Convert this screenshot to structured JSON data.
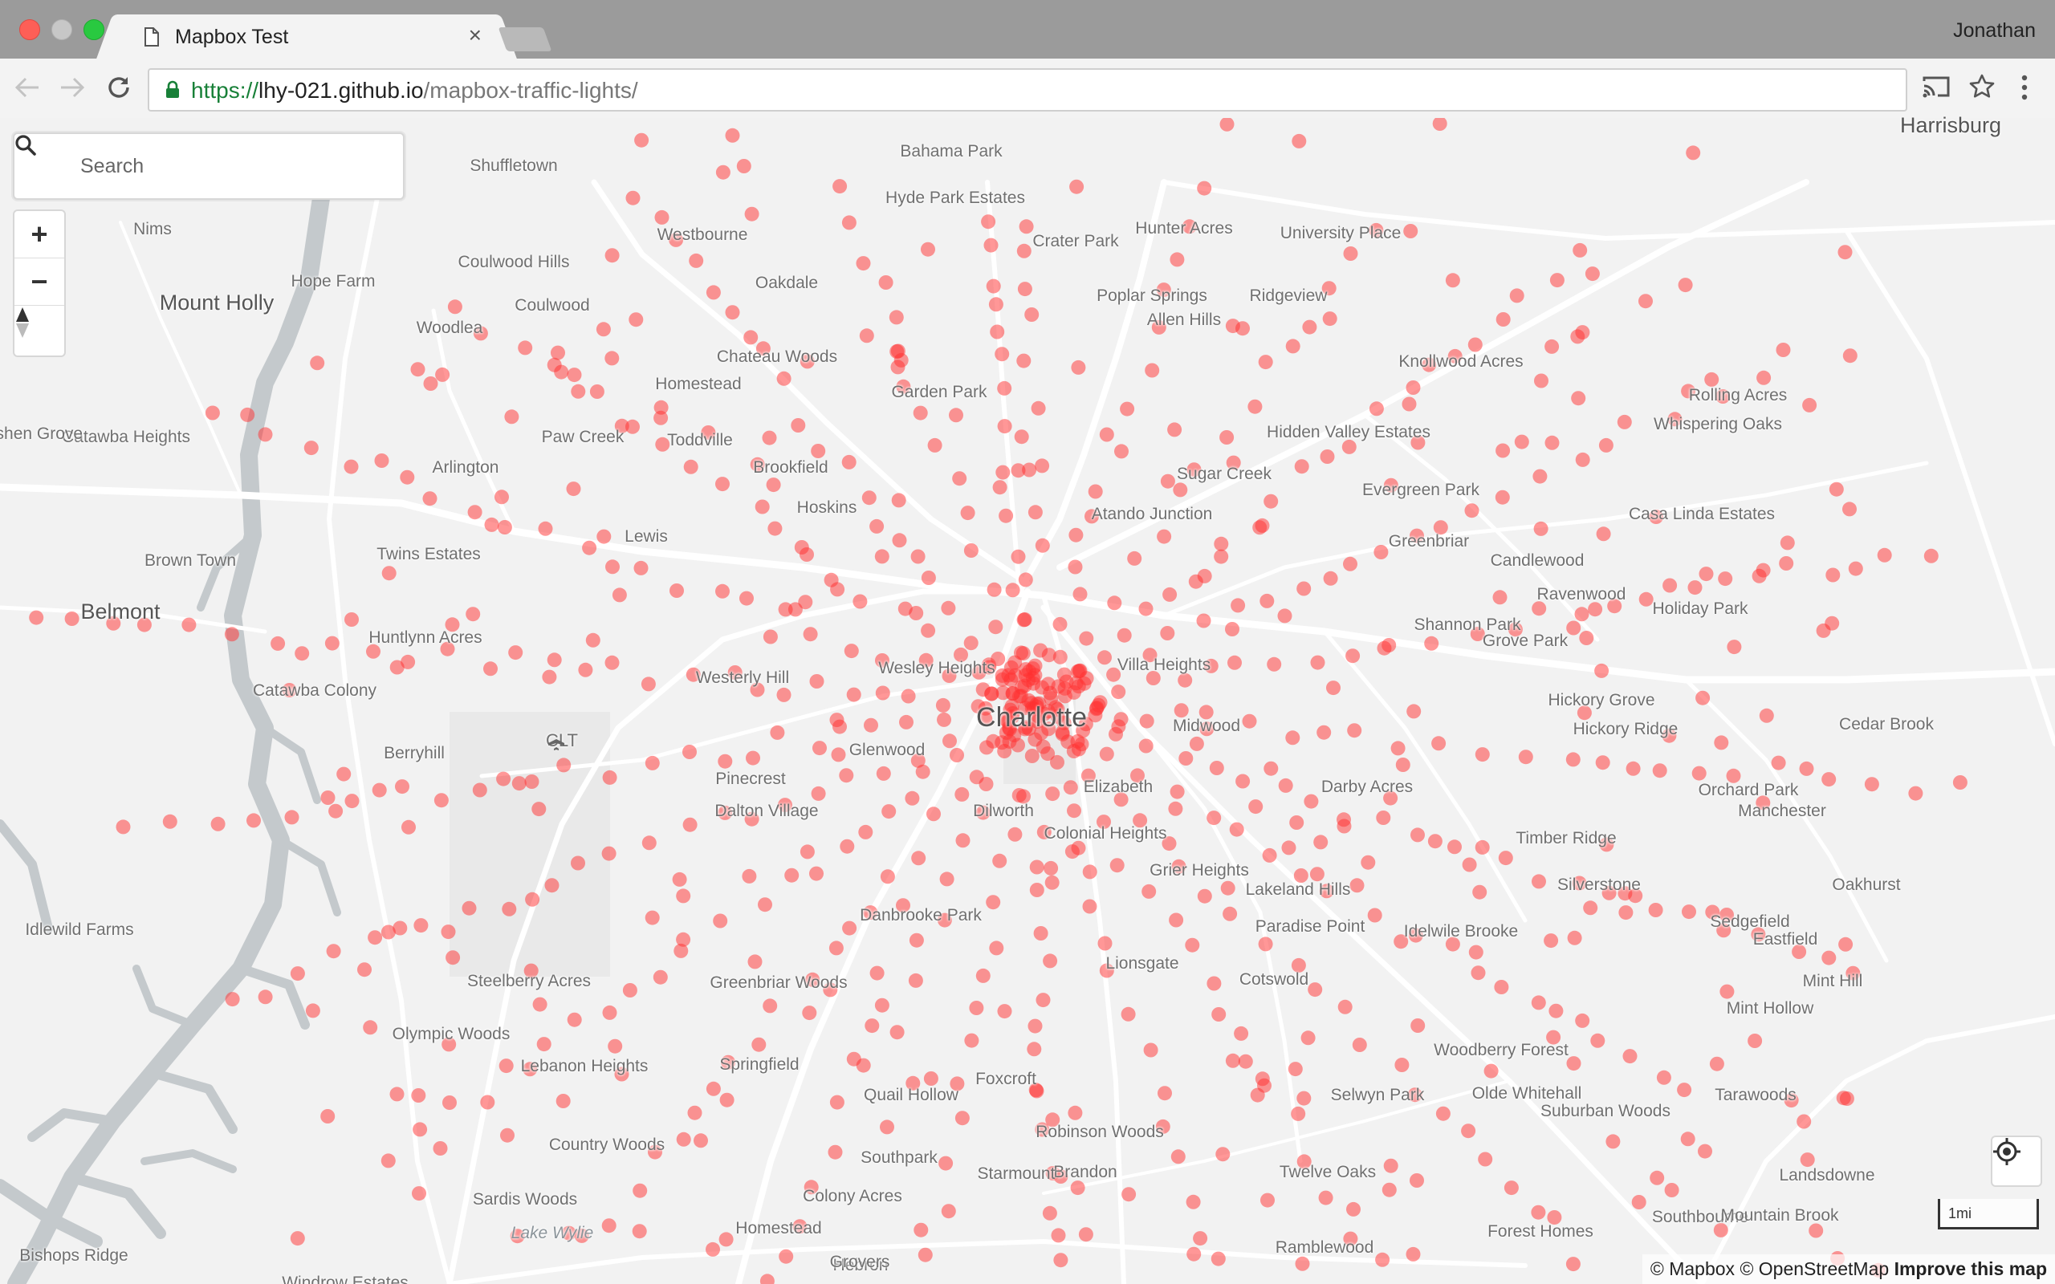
{
  "window": {
    "user_name": "Jonathan"
  },
  "tab": {
    "title": "Mapbox Test",
    "close": "×"
  },
  "address_bar": {
    "scheme": "https://",
    "host": "lhy-021.github.io",
    "path": "/mapbox-traffic-lights/"
  },
  "map": {
    "search_placeholder": "Search",
    "zoom_in": "+",
    "zoom_out": "−",
    "scale_label": "1mi",
    "attribution": [
      "© Mapbox",
      "© OpenStreetMap",
      "Improve this map"
    ],
    "airport_code": "CLT",
    "dot_color": "#ff3030",
    "places": [
      [
        "Harrisburg",
        "big"
      ],
      [
        "Shuffletown",
        ""
      ],
      [
        "Bahama Park",
        ""
      ],
      [
        "Hyde Park Estates",
        ""
      ],
      [
        "Hunter Acres",
        ""
      ],
      [
        "University Place",
        ""
      ],
      [
        "Nims",
        ""
      ],
      [
        "Westbourne",
        ""
      ],
      [
        "Crater Park",
        ""
      ],
      [
        "Coulwood Hills",
        ""
      ],
      [
        "Oakdale",
        ""
      ],
      [
        "Hope Farm",
        ""
      ],
      [
        "Mount Holly",
        "big"
      ],
      [
        "Coulwood",
        ""
      ],
      [
        "Poplar Springs",
        ""
      ],
      [
        "Ridgeview",
        ""
      ],
      [
        "Allen Hills",
        ""
      ],
      [
        "Woodlea",
        ""
      ],
      [
        "Chateau Woods",
        ""
      ],
      [
        "Knollwood Acres",
        ""
      ],
      [
        "Homestead",
        ""
      ],
      [
        "Garden Park",
        ""
      ],
      [
        "Rolling Acres",
        ""
      ],
      [
        "Whispering Oaks",
        ""
      ],
      [
        "Hidden Valley Estates",
        ""
      ],
      [
        "Catawba Heights",
        ""
      ],
      [
        "Paw Creek",
        ""
      ],
      [
        "Toddville",
        ""
      ],
      [
        "ashen Grove",
        ""
      ],
      [
        "Brookfield",
        ""
      ],
      [
        "Sugar Creek",
        ""
      ],
      [
        "Arlington",
        ""
      ],
      [
        "Evergreen Park",
        ""
      ],
      [
        "Hoskins",
        ""
      ],
      [
        "Atando Junction",
        ""
      ],
      [
        "Casa Linda Estates",
        ""
      ],
      [
        "Lewis",
        ""
      ],
      [
        "Greenbriar",
        ""
      ],
      [
        "Twins Estates",
        ""
      ],
      [
        "Brown Town",
        ""
      ],
      [
        "Candlewood",
        ""
      ],
      [
        "Ravenwood",
        ""
      ],
      [
        "Holiday Park",
        ""
      ],
      [
        "Belmont",
        "big"
      ],
      [
        "Shannon Park",
        ""
      ],
      [
        "Huntlynn Acres",
        ""
      ],
      [
        "Grove Park",
        ""
      ],
      [
        "Villa Heights",
        ""
      ],
      [
        "Wesley Heights",
        ""
      ],
      [
        "Westerly Hill",
        ""
      ],
      [
        "Catawba Colony",
        ""
      ],
      [
        "Charlotte",
        "city"
      ],
      [
        "Hickory Grove",
        ""
      ],
      [
        "Cedar Brook",
        ""
      ],
      [
        "Midwood",
        ""
      ],
      [
        "Hickory Ridge",
        ""
      ],
      [
        "Berryhill",
        ""
      ],
      [
        "Glenwood",
        ""
      ],
      [
        "Pinecrest",
        ""
      ],
      [
        "Darby Acres",
        ""
      ],
      [
        "Elizabeth",
        ""
      ],
      [
        "Orchard Park",
        ""
      ],
      [
        "Dalton Village",
        ""
      ],
      [
        "Dilworth",
        ""
      ],
      [
        "Manchester",
        ""
      ],
      [
        "Colonial Heights",
        ""
      ],
      [
        "Timber Ridge",
        ""
      ],
      [
        "Grier Heights",
        ""
      ],
      [
        "Silverstone",
        ""
      ],
      [
        "Oakhurst",
        ""
      ],
      [
        "Lakeland Hills",
        ""
      ],
      [
        "Sedgefield",
        ""
      ],
      [
        "Idlewild Farms",
        ""
      ],
      [
        "Paradise Point",
        ""
      ],
      [
        "Eastfield",
        ""
      ],
      [
        "Danbrooke Park",
        ""
      ],
      [
        "Idelwile Brooke",
        ""
      ],
      [
        "Lionsgate",
        ""
      ],
      [
        "Steelberry Acres",
        ""
      ],
      [
        "Greenbriar Woods",
        ""
      ],
      [
        "Cotswold",
        ""
      ],
      [
        "Mint Hill",
        ""
      ],
      [
        "Mint Hollow",
        ""
      ],
      [
        "Olympic Woods",
        ""
      ],
      [
        "Springfield",
        ""
      ],
      [
        "Foxcroft",
        ""
      ],
      [
        "Woodberry Forest",
        ""
      ],
      [
        "Quail Hollow",
        ""
      ],
      [
        "Lebanon Heights",
        ""
      ],
      [
        "Tarawoods",
        ""
      ],
      [
        "Selwyn Park",
        ""
      ],
      [
        "Suburban Woods",
        ""
      ],
      [
        "Robinson Woods",
        ""
      ],
      [
        "Olde Whitehall",
        ""
      ],
      [
        "Southpark",
        ""
      ],
      [
        "Country Woods",
        ""
      ],
      [
        "Brandon",
        ""
      ],
      [
        "Landsdowne",
        ""
      ],
      [
        "Starmount",
        ""
      ],
      [
        "Twelve Oaks",
        ""
      ],
      [
        "Colony Acres",
        ""
      ],
      [
        "Sardis Woods",
        ""
      ],
      [
        "Homestead",
        ""
      ],
      [
        "Southbourne",
        ""
      ],
      [
        "Mountain Brook",
        ""
      ],
      [
        "Forest Homes",
        ""
      ],
      [
        "Lake Wylie",
        "water"
      ],
      [
        "Bishops Ridge",
        ""
      ],
      [
        "Ramblewood",
        ""
      ],
      [
        "Hebron",
        ""
      ],
      [
        "Grovers",
        ""
      ],
      [
        "Windrow Estates",
        ""
      ]
    ]
  }
}
